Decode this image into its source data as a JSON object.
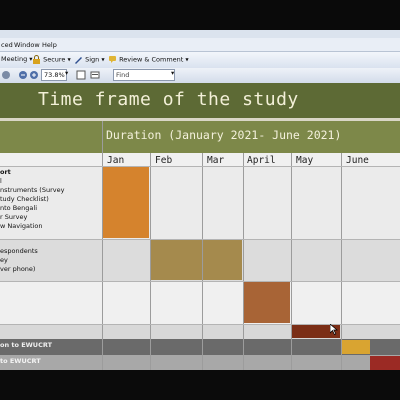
{
  "menu": [
    "ced",
    "Window",
    "Help"
  ],
  "toolbar": {
    "meeting": "Meeting",
    "secure": "Secure",
    "sign": "Sign",
    "review": "Review & Comment",
    "zoom": "73.8%",
    "find_placeholder": "Find"
  },
  "slide": {
    "title": "Time frame of the study",
    "duration": "Duration (January 2021- June 2021)",
    "months": [
      "Jan",
      "Feb",
      "Mar",
      "April",
      "May",
      "June"
    ],
    "groups": [
      {
        "lines": [
          "ort",
          "l",
          "nstruments (Survey",
          "tudy Checklist)",
          "nto Bengali",
          "r Survey",
          "w Navigation"
        ]
      },
      {
        "lines": [
          "espondents",
          "ey",
          "ver phone)"
        ]
      },
      {
        "lines": [
          ""
        ]
      },
      {
        "lines": [
          "on to EWUCRT"
        ]
      },
      {
        "lines": [
          "to EWUCRT"
        ]
      }
    ],
    "bar_colors": [
      "#d5832d",
      "#a58a4d",
      "#a86436",
      "#7b2e16",
      "#d9a431",
      "#9b2a24"
    ],
    "accent_olive": "#5d6a35",
    "accent_olive_light": "#7d8849"
  }
}
